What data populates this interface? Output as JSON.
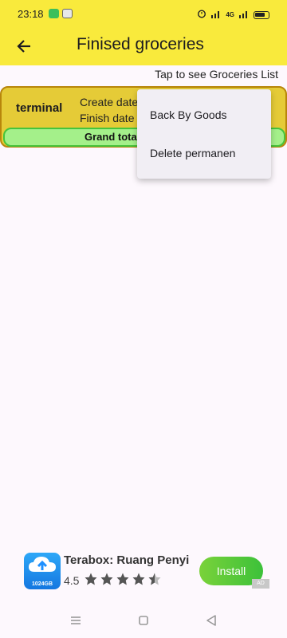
{
  "status_bar": {
    "time": "23:18",
    "signal_text": "4G"
  },
  "app_bar": {
    "title": "Finised groceries"
  },
  "hint": "Tap to see Groceries List",
  "card": {
    "name": "terminal",
    "create_date_label": "Create date",
    "finish_date_label": "Finish date",
    "grand_total_label": "Grand total"
  },
  "menu": {
    "items": [
      {
        "label": "Back By Goods"
      },
      {
        "label": "Delete permanen"
      }
    ]
  },
  "ad": {
    "app_name": "Terabox: Ruang Penyi",
    "logo_label": "1024GB",
    "rating": "4.5",
    "stars": 4.5,
    "install_label": "Install",
    "badge": "AD"
  },
  "colors": {
    "app_bar": "#f9ea3c",
    "card": "#e5cb37",
    "grand_total": "#a4f08a",
    "install": "#4cc63a"
  }
}
